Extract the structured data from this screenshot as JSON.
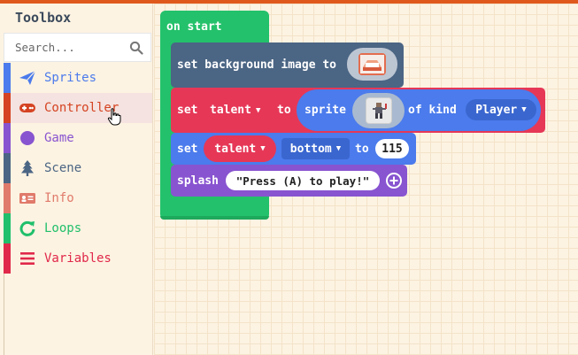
{
  "toolbox": {
    "title": "Toolbox",
    "search_placeholder": "Search...",
    "categories": [
      {
        "label": "Sprites",
        "color": "#4b7bec",
        "text_color": "#4b7bec",
        "icon": "paper-plane-icon"
      },
      {
        "label": "Controller",
        "color": "#d54322",
        "text_color": "#d54322",
        "icon": "gamepad-icon"
      },
      {
        "label": "Game",
        "color": "#8854d0",
        "text_color": "#8854d0",
        "icon": "circle-icon"
      },
      {
        "label": "Scene",
        "color": "#4b6584",
        "text_color": "#4b6584",
        "icon": "tree-icon"
      },
      {
        "label": "Info",
        "color": "#e07a6b",
        "text_color": "#e07a6b",
        "icon": "id-card-icon"
      },
      {
        "label": "Loops",
        "color": "#20bf6b",
        "text_color": "#20bf6b",
        "icon": "loop-icon"
      },
      {
        "label": "Variables",
        "color": "#e0284a",
        "text_color": "#e0284a",
        "icon": "list-icon"
      }
    ]
  },
  "blocks": {
    "on_start": {
      "label": "on start",
      "color": "#23c16b"
    },
    "set_background": {
      "label": "set background image to",
      "color": "#4b6584"
    },
    "set_talent": {
      "set_label": "set",
      "var_name": "talent",
      "to_label": "to",
      "sprite_label": "sprite",
      "of_kind_label": "of kind",
      "kind_value": "Player",
      "color": "#e63757",
      "sprite_color": "#4b7bec"
    },
    "set_bottom": {
      "set_label": "set",
      "var_name": "talent",
      "prop": "bottom",
      "to_label": "to",
      "value": "115",
      "color": "#4b7bec"
    },
    "splash": {
      "label": "splash",
      "text": "\"Press (A) to play!\"",
      "color": "#8854d0"
    }
  }
}
